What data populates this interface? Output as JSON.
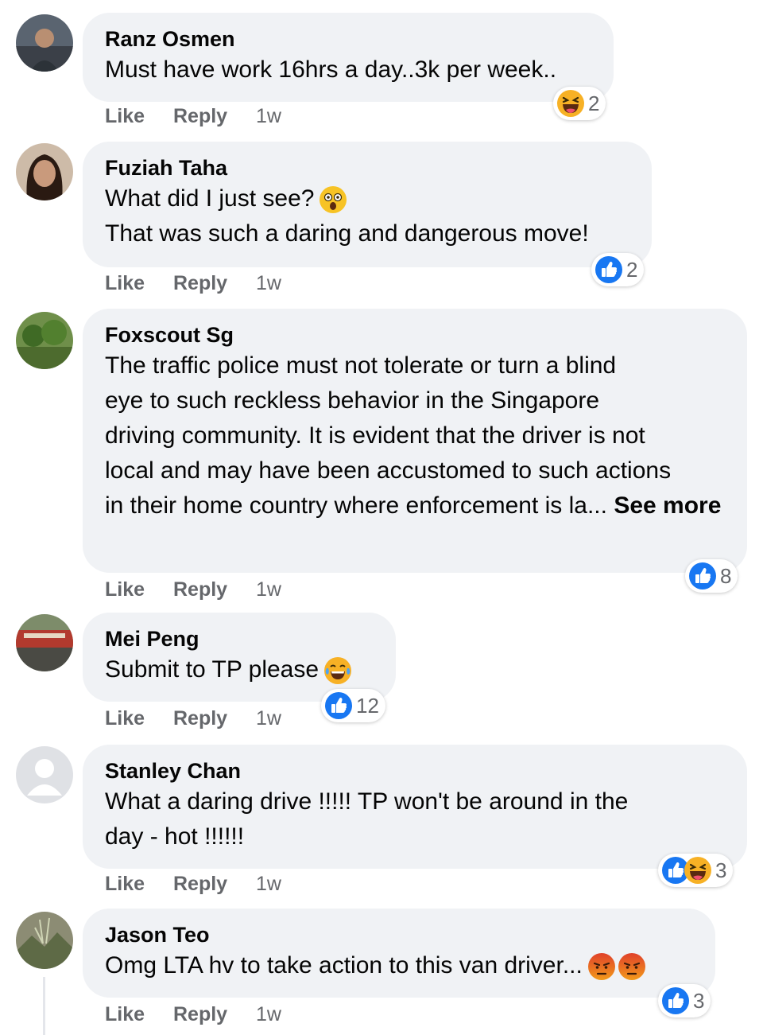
{
  "comments": [
    {
      "name": "Ranz Osmen",
      "lines": [
        "Must have work 16hrs a day..3k per week.."
      ],
      "actions": {
        "like": "Like",
        "reply": "Reply",
        "time": "1w"
      },
      "reaction_icons": [
        "haha-icon"
      ],
      "reaction_count": "2"
    },
    {
      "name": "Fuziah Taha",
      "lines": [
        "What did I just see?",
        "That was such a daring and dangerous move!"
      ],
      "inline_emoji": "shocked-emoji",
      "actions": {
        "like": "Like",
        "reply": "Reply",
        "time": "1w"
      },
      "reaction_icons": [
        "like-icon"
      ],
      "reaction_count": "2"
    },
    {
      "name": "Foxscout Sg",
      "lines": [
        "The traffic police must not tolerate or turn a blind",
        "eye to such reckless behavior in the Singapore",
        "driving community. It is evident that the driver is not",
        "local and may have been accustomed to such actions",
        "in their home country where enforcement is la..."
      ],
      "see_more": "See more",
      "actions": {
        "like": "Like",
        "reply": "Reply",
        "time": "1w"
      },
      "reaction_icons": [
        "like-icon"
      ],
      "reaction_count": "8"
    },
    {
      "name": "Mei Peng",
      "lines": [
        "Submit to TP please"
      ],
      "inline_emoji": "tears-of-joy-emoji",
      "actions": {
        "like": "Like",
        "reply": "Reply",
        "time": "1w"
      },
      "reaction_icons": [
        "like-icon"
      ],
      "reaction_count": "12"
    },
    {
      "name": "Stanley Chan",
      "lines": [
        "What a daring drive !!!!! TP won't be around in the",
        "day - hot !!!!!!"
      ],
      "actions": {
        "like": "Like",
        "reply": "Reply",
        "time": "1w"
      },
      "reaction_icons": [
        "like-icon",
        "haha-icon"
      ],
      "reaction_count": "3"
    },
    {
      "name": "Jason Teo",
      "lines": [
        "Omg LTA hv to take action to this van driver..."
      ],
      "inline_emoji": "angry-emoji",
      "actions": {
        "like": "Like",
        "reply": "Reply",
        "time": "1w"
      },
      "reaction_icons": [
        "like-icon"
      ],
      "reaction_count": "3"
    }
  ],
  "colors": {
    "bubble": "#f0f2f5",
    "like_blue": "#1877f2",
    "meta_gray": "#65676b",
    "emoji_yellow": "#f7b125",
    "angry_red": "#e9710f"
  }
}
